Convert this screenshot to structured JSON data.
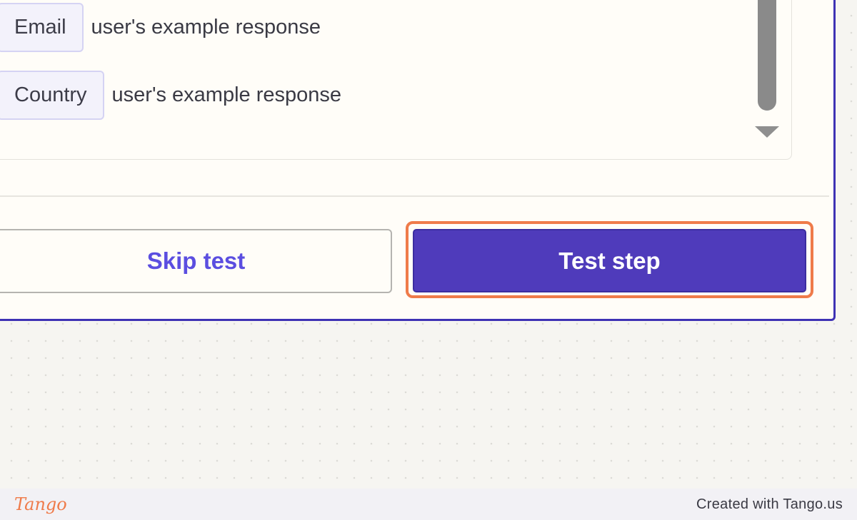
{
  "fields": [
    {
      "label": "Email",
      "value": "user's example response"
    },
    {
      "label": "Country",
      "value": "user's example response"
    }
  ],
  "actions": {
    "skip_label": "Skip test",
    "test_label": "Test step"
  },
  "footer": {
    "logo": "Tango",
    "credit": "Created with Tango.us"
  },
  "colors": {
    "accent": "#4f3bbb",
    "highlight": "#ef7b4a",
    "link": "#5b4ee0"
  }
}
